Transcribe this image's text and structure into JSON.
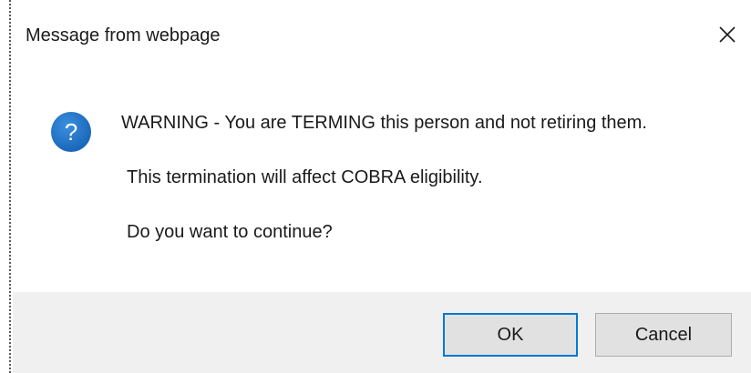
{
  "dialog": {
    "title": "Message from webpage",
    "close_icon": "close-icon",
    "message_icon": "question-icon",
    "accent_color": "#0078d7",
    "icon_color": "#1a73c7"
  },
  "message": {
    "line1": "WARNING - You are TERMING this person and not retiring them.",
    "line2": "This termination will affect COBRA eligibility.",
    "line3": "Do you want to continue?"
  },
  "buttons": {
    "ok_label": "OK",
    "cancel_label": "Cancel"
  }
}
